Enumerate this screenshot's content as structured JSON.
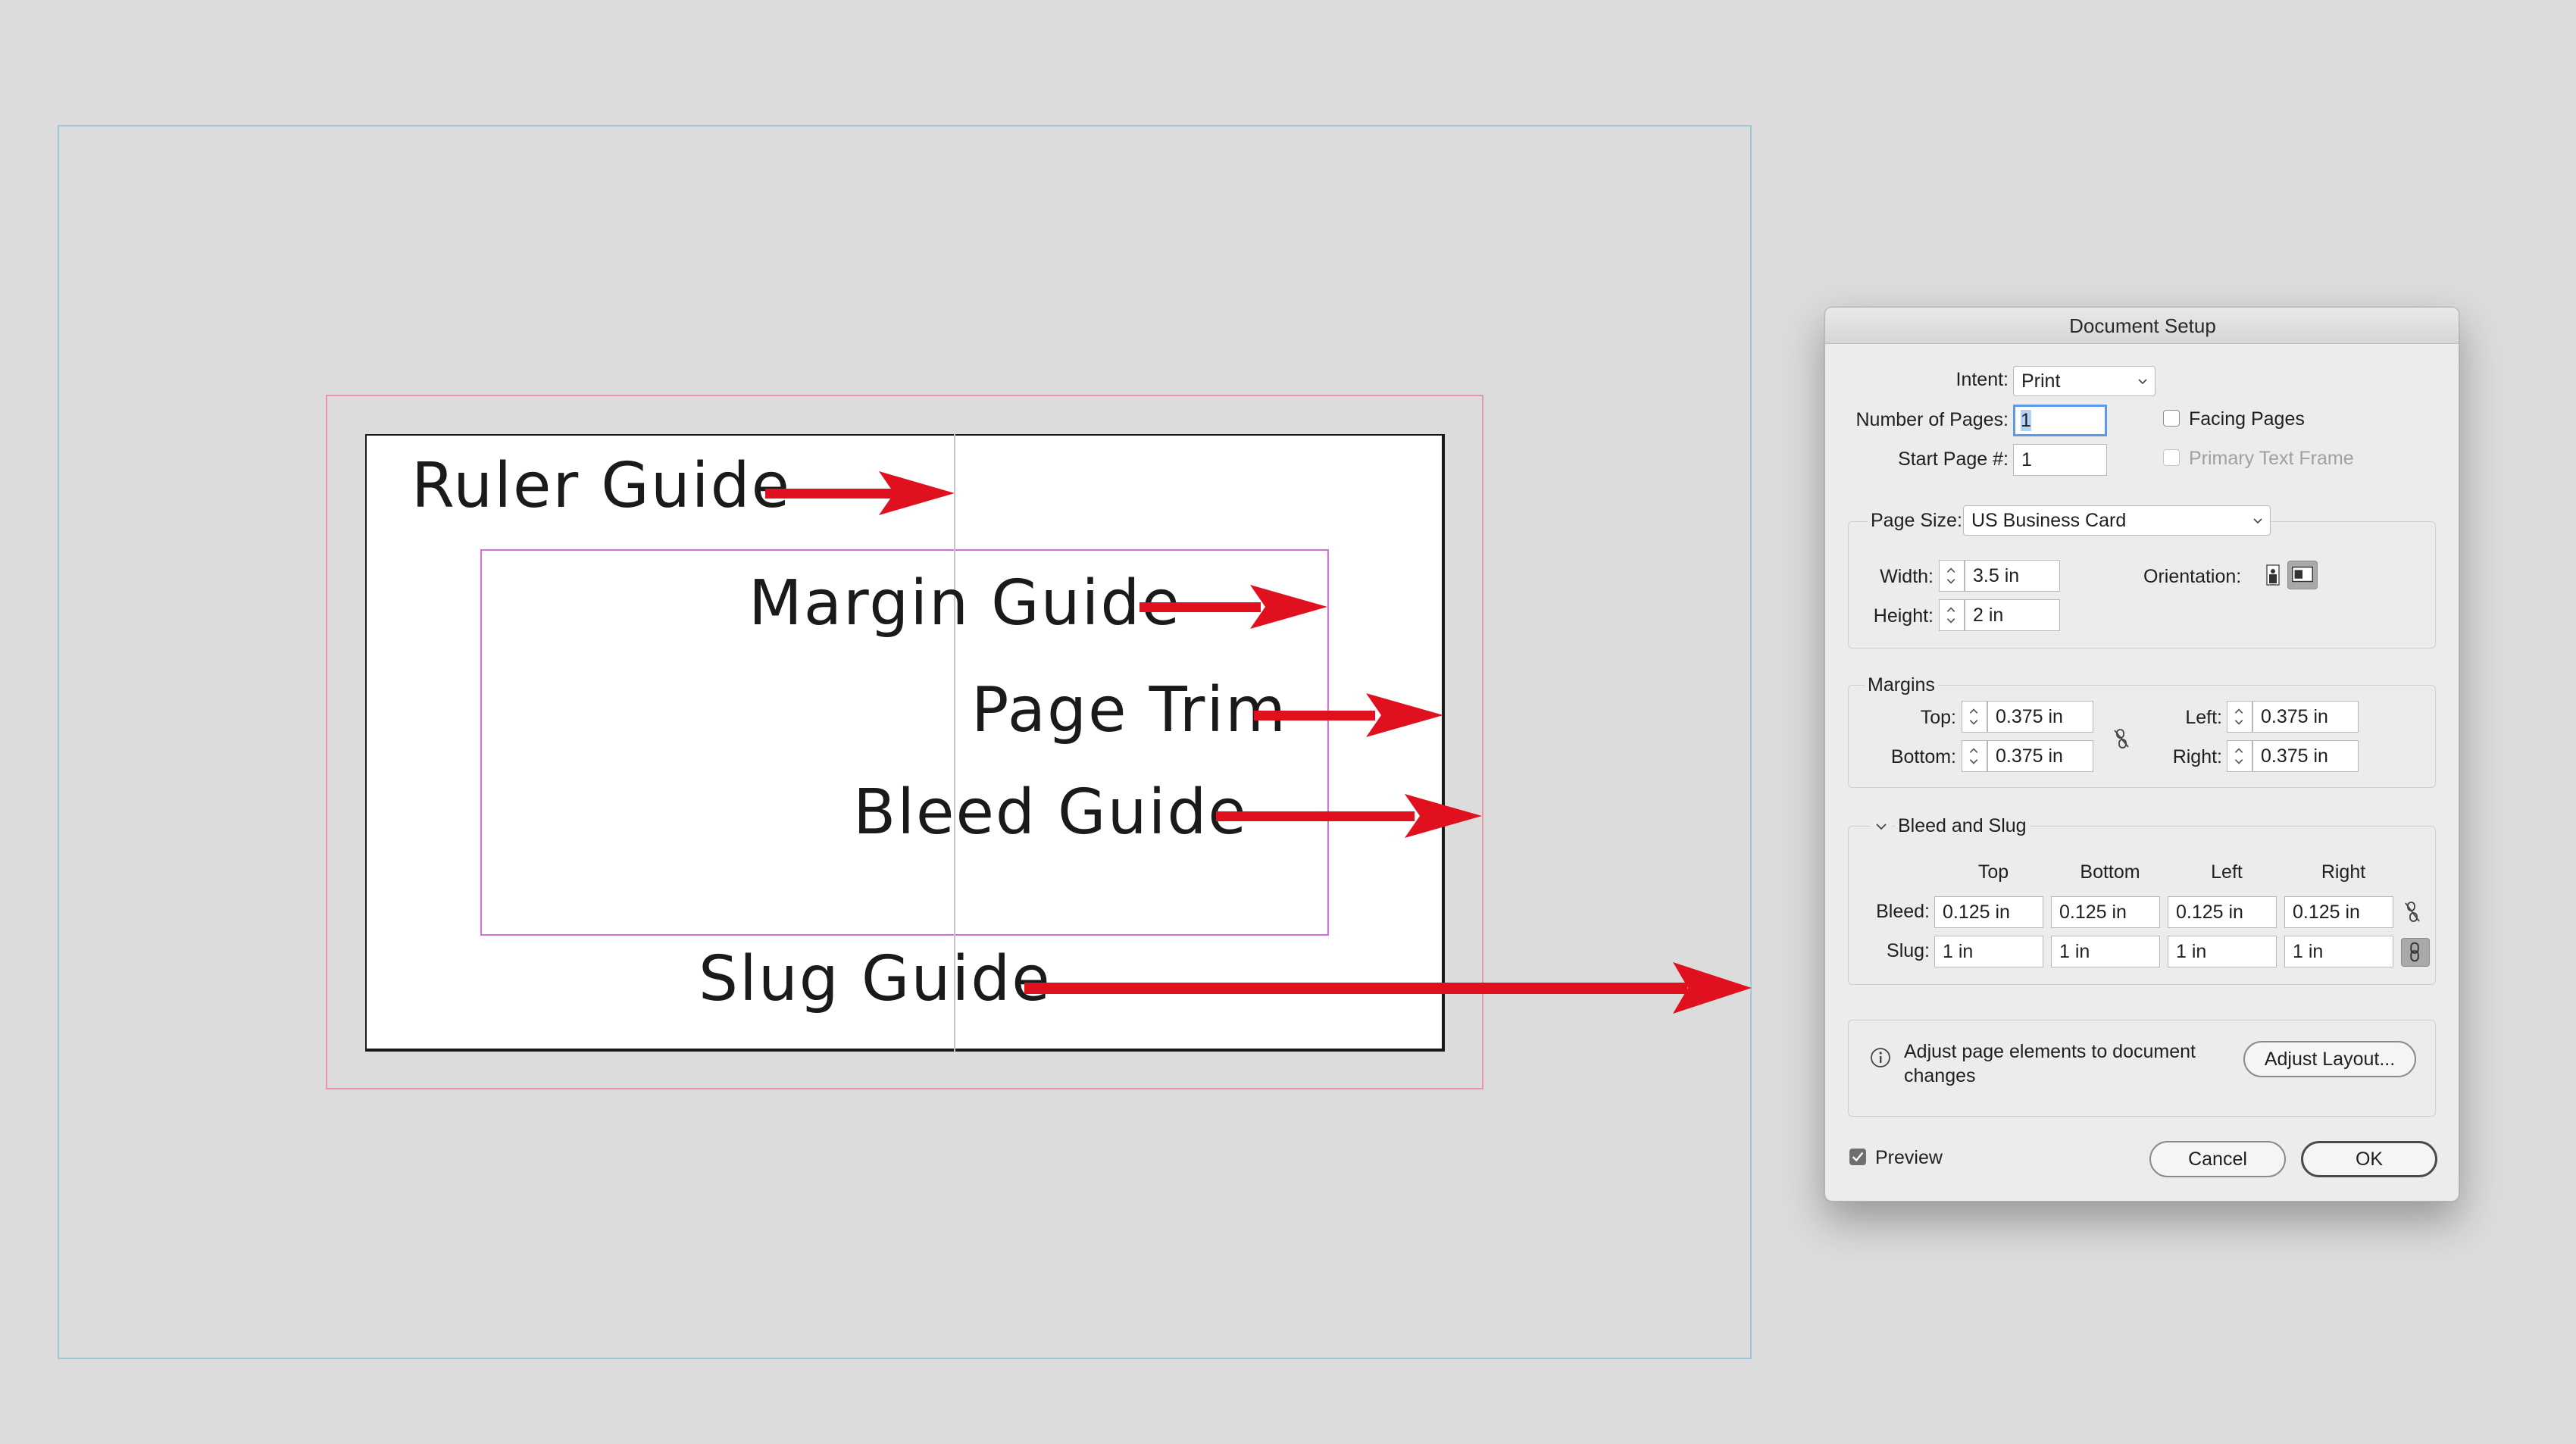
{
  "diagram": {
    "labels": {
      "ruler": "Ruler  Guide",
      "margin": "Margin Guide",
      "trim": "Page Trim",
      "bleed": "Bleed Guide",
      "slug": "Slug Guide"
    },
    "colors": {
      "arrow": "#e0101e",
      "slug_guide": "#9cc8d8",
      "bleed_guide": "#e896a6",
      "margin_guide": "#d070d8",
      "ruler_guide": "#c7c1d8",
      "page": "#ffffff",
      "canvas": "#dcdcdc"
    }
  },
  "dialog": {
    "title": "Document Setup",
    "intent": {
      "label": "Intent:",
      "value": "Print"
    },
    "pages": {
      "label": "Number of Pages:",
      "value": "1"
    },
    "start_page": {
      "label": "Start Page #:",
      "value": "1"
    },
    "facing_pages": {
      "label": "Facing Pages",
      "checked": false
    },
    "primary_text_frame": {
      "label": "Primary Text Frame",
      "checked": false,
      "disabled": true
    },
    "page_size": {
      "label": "Page Size:",
      "value": "US Business Card",
      "width_label": "Width:",
      "width": "3.5 in",
      "height_label": "Height:",
      "height": "2 in",
      "orientation_label": "Orientation:",
      "orientation": "landscape"
    },
    "margins": {
      "title": "Margins",
      "top_label": "Top:",
      "top": "0.375 in",
      "bottom_label": "Bottom:",
      "bottom": "0.375 in",
      "left_label": "Left:",
      "left": "0.375 in",
      "right_label": "Right:",
      "right": "0.375 in",
      "linked": false
    },
    "bleed_slug": {
      "title": "Bleed and Slug",
      "columns": [
        "Top",
        "Bottom",
        "Left",
        "Right"
      ],
      "bleed_label": "Bleed:",
      "bleed": [
        "0.125 in",
        "0.125 in",
        "0.125 in",
        "0.125 in"
      ],
      "slug_label": "Slug:",
      "slug": [
        "1 in",
        "1 in",
        "1 in",
        "1 in"
      ],
      "bleed_linked": false,
      "slug_linked": true
    },
    "adjust": {
      "text": "Adjust page elements to document changes",
      "line1": "Adjust page elements to document",
      "line2": "changes",
      "button": "Adjust Layout..."
    },
    "preview": {
      "label": "Preview",
      "checked": true
    },
    "cancel": "Cancel",
    "ok": "OK"
  }
}
